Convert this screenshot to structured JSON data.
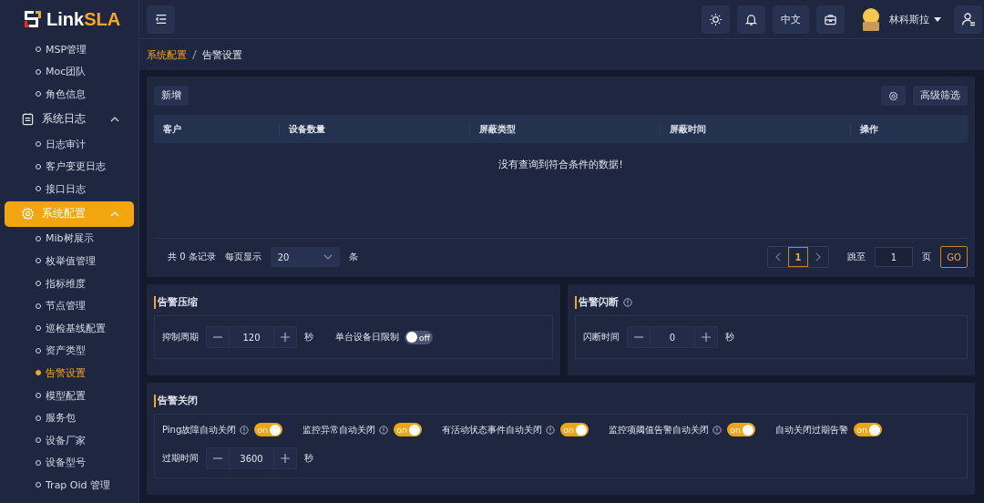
{
  "logo": {
    "part_a": "Link",
    "part_b": "SLA"
  },
  "sidebar": {
    "items": [
      {
        "kind": "sub",
        "label": "MSP管理",
        "selected": false
      },
      {
        "kind": "sub",
        "label": "Moc团队",
        "selected": false
      },
      {
        "kind": "sub",
        "label": "角色信息",
        "selected": false
      },
      {
        "kind": "group",
        "label": "系统日志",
        "expanded": true,
        "selected": false,
        "children": [
          {
            "label": "日志审计",
            "selected": false
          },
          {
            "label": "客户变更日志",
            "selected": false
          },
          {
            "label": "接口日志",
            "selected": false
          }
        ]
      },
      {
        "kind": "group",
        "label": "系统配置",
        "expanded": true,
        "selected": true,
        "children": [
          {
            "label": "Mib树展示",
            "selected": false
          },
          {
            "label": "枚举值管理",
            "selected": false
          },
          {
            "label": "指标维度",
            "selected": false
          },
          {
            "label": "节点管理",
            "selected": false
          },
          {
            "label": "巡检基线配置",
            "selected": false
          },
          {
            "label": "资产类型",
            "selected": false
          },
          {
            "label": "告警设置",
            "selected": true
          },
          {
            "label": "模型配置",
            "selected": false
          },
          {
            "label": "服务包",
            "selected": false
          },
          {
            "label": "设备厂家",
            "selected": false
          },
          {
            "label": "设备型号",
            "selected": false
          },
          {
            "label": "Trap Oid 管理",
            "selected": false
          }
        ]
      }
    ]
  },
  "topbar": {
    "language": "中文",
    "user_name": "林科斯拉"
  },
  "breadcrumb": [
    "系统配置",
    "告警设置"
  ],
  "table": {
    "add_button": "新增",
    "filter_button": "高级筛选",
    "columns": [
      "客户",
      "设备数量",
      "屏蔽类型",
      "屏蔽时间",
      "操作"
    ],
    "empty_text": "没有查询到符合条件的数据!",
    "pagination": {
      "total": "共 0 条记录",
      "page_size_label": "每页显示",
      "page_size": "20",
      "page_size_unit": "条",
      "pages": [
        {
          "label": "1",
          "selected": true
        }
      ],
      "jump_label": "跳至",
      "jump_value": "1",
      "jump_unit": "页",
      "go": "GO"
    }
  },
  "sections": [
    {
      "title": "告警压缩",
      "info": false,
      "fields": [
        {
          "kind": "stepper",
          "label": "抑制周期",
          "value": "120",
          "unit": "秒"
        },
        {
          "kind": "switch",
          "label": "单台设备日限制",
          "info": false,
          "on": false,
          "switch_text": "off"
        }
      ]
    },
    {
      "title": "告警闪断",
      "info": true,
      "fields": [
        {
          "kind": "stepper",
          "label": "闪断时间",
          "value": "0",
          "unit": "秒"
        }
      ]
    },
    {
      "title": "告警关闭",
      "info": false,
      "fields": [
        {
          "kind": "switch",
          "label": "Ping故障自动关闭",
          "info": true,
          "on": true,
          "switch_text": "on"
        },
        {
          "kind": "switch",
          "label": "监控异常自动关闭",
          "info": true,
          "on": true,
          "switch_text": "on"
        },
        {
          "kind": "switch",
          "label": "有活动状态事件自动关闭",
          "info": true,
          "on": true,
          "switch_text": "on"
        },
        {
          "kind": "switch",
          "label": "监控项阈值告警自动关闭",
          "info": true,
          "on": true,
          "switch_text": "on"
        },
        {
          "kind": "switch",
          "label": "自动关闭过期告警",
          "info": false,
          "on": true,
          "switch_text": "on"
        },
        {
          "kind": "break"
        },
        {
          "kind": "stepper",
          "label": "过期时间",
          "value": "3600",
          "unit": "秒"
        }
      ]
    }
  ]
}
